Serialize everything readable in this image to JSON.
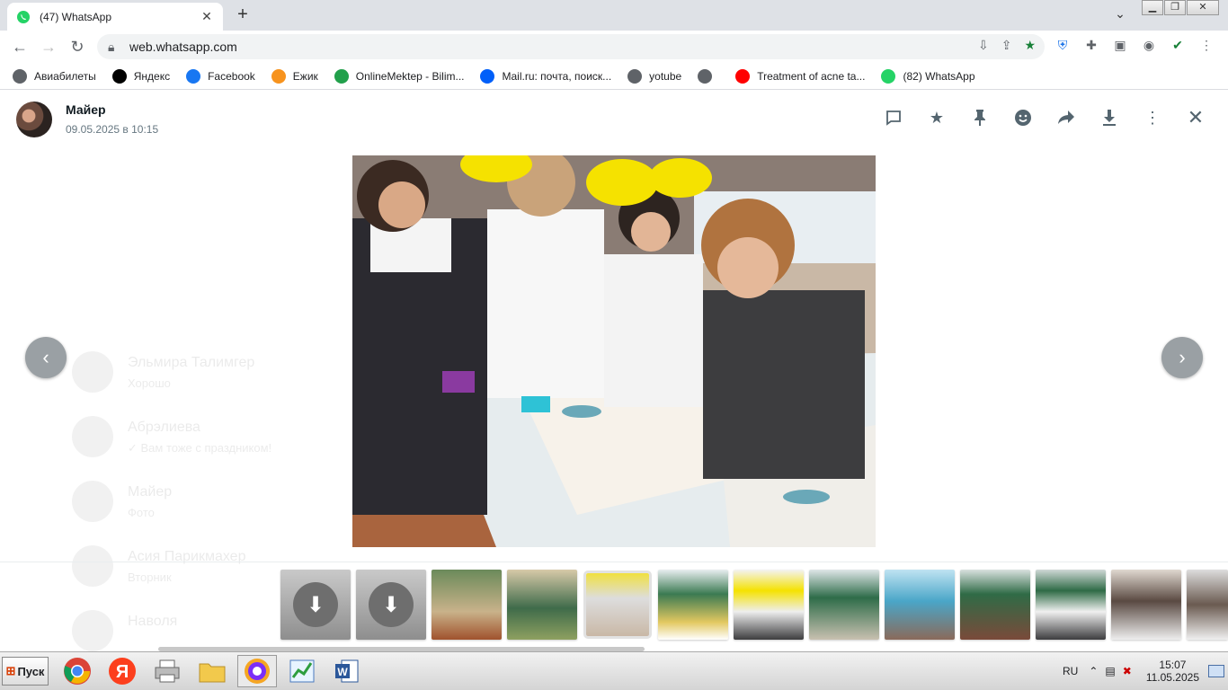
{
  "tab": {
    "title": "(47) WhatsApp",
    "close": "✕",
    "new_tab": "+"
  },
  "address": {
    "url": "web.whatsapp.com"
  },
  "bookmarks": [
    {
      "label": "Авиабилеты",
      "icon": "globe-icon",
      "color": "#5f6368"
    },
    {
      "label": "Яндекс",
      "icon": "yandex-icon",
      "color": "#000000"
    },
    {
      "label": "Facebook",
      "icon": "facebook-icon",
      "color": "#1877f2"
    },
    {
      "label": "Ежик",
      "icon": "odnoklassniki-icon",
      "color": "#f7931e"
    },
    {
      "label": "OnlineMektep - Bilim...",
      "icon": "onlinemektep-icon",
      "color": "#22a04b"
    },
    {
      "label": "Mail.ru: почта, поиск...",
      "icon": "mail-icon",
      "color": "#005ff9"
    },
    {
      "label": "yotube",
      "icon": "globe-icon",
      "color": "#5f6368"
    },
    {
      "label": "",
      "icon": "globe-icon",
      "color": "#5f6368"
    },
    {
      "label": "Treatment of acne ta...",
      "icon": "youtube-icon",
      "color": "#ff0000"
    },
    {
      "label": "(82) WhatsApp",
      "icon": "whatsapp-icon",
      "color": "#25d366"
    }
  ],
  "viewer": {
    "sender_name": "Майер",
    "sender_date": "09.05.2025 в 10:15"
  },
  "background_chats": [
    {
      "name": "Эльмира Талимгер",
      "sub": "Хорошо"
    },
    {
      "name": "Абрэлиева",
      "sub": "✓ Вам тоже с праздником!"
    },
    {
      "name": "Майер",
      "sub": "Фото"
    },
    {
      "name": "Асия Парикмахер",
      "sub": "Вторник"
    },
    {
      "name": "Наволя",
      "sub": ""
    }
  ],
  "taskbar": {
    "start_label": "Пуск",
    "lang": "RU",
    "time": "15:07",
    "date": "11.05.2025"
  },
  "colors": {
    "whatsapp_green": "#25d366",
    "chrome_tabstrip": "#dee1e6",
    "star_green": "#188038"
  }
}
